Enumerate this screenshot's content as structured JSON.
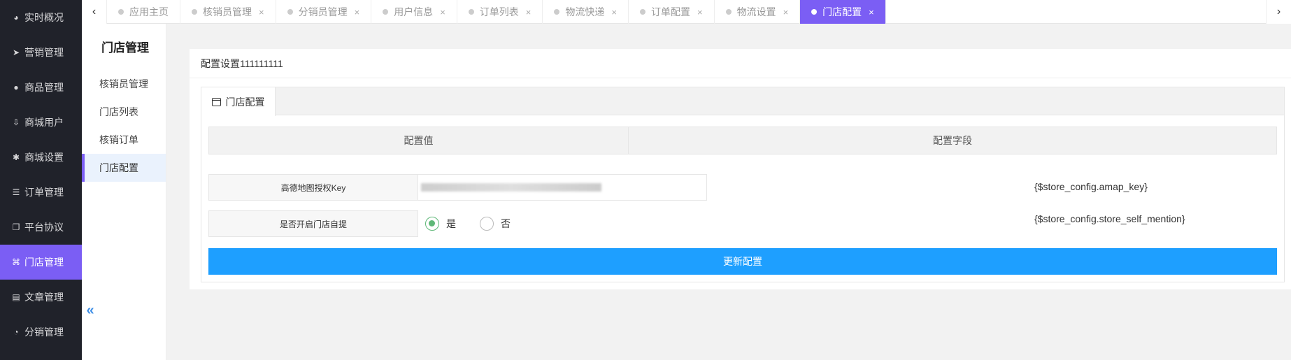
{
  "sidebar": {
    "items": [
      {
        "label": "实时概况",
        "icon": "dashboard-icon",
        "glyph": "◕"
      },
      {
        "label": "营销管理",
        "icon": "paper-plane-icon",
        "glyph": "➤"
      },
      {
        "label": "商品管理",
        "icon": "reddit-icon",
        "glyph": "●"
      },
      {
        "label": "商城用户",
        "icon": "user-upload-icon",
        "glyph": "⇩"
      },
      {
        "label": "商城设置",
        "icon": "asterisk-icon",
        "glyph": "✱"
      },
      {
        "label": "订单管理",
        "icon": "list-icon",
        "glyph": "☰"
      },
      {
        "label": "平台协议",
        "icon": "copy-icon",
        "glyph": "❐"
      },
      {
        "label": "门店管理",
        "icon": "binoculars-icon",
        "glyph": "⌘"
      },
      {
        "label": "文章管理",
        "icon": "book-icon",
        "glyph": "▤"
      },
      {
        "label": "分销管理",
        "icon": "pie-chart-icon",
        "glyph": "◔"
      }
    ],
    "active_index": 7
  },
  "subsidebar": {
    "title": "门店管理",
    "items": [
      "核销员管理",
      "门店列表",
      "核销订单",
      "门店配置"
    ],
    "active_index": 3,
    "collapse_glyph": "«"
  },
  "tabbar": {
    "left_arrow": "‹",
    "right_arrow": "›",
    "tabs": [
      {
        "label": "应用主页",
        "closable": false
      },
      {
        "label": "核销员管理",
        "closable": true
      },
      {
        "label": "分销员管理",
        "closable": true
      },
      {
        "label": "用户信息",
        "closable": true
      },
      {
        "label": "订单列表",
        "closable": true
      },
      {
        "label": "物流快递",
        "closable": true
      },
      {
        "label": "订单配置",
        "closable": true
      },
      {
        "label": "物流设置",
        "closable": true
      },
      {
        "label": "门店配置",
        "closable": true
      }
    ],
    "active_index": 8,
    "close_glyph": "×"
  },
  "card": {
    "title": "配置设置111111111",
    "panel_tab": "门店配置",
    "table_headers": {
      "value": "配置值",
      "field": "配置字段"
    },
    "rows": [
      {
        "label": "高德地图授权Key",
        "type": "text",
        "value": "",
        "field": "{$store_config.amap_key}"
      },
      {
        "label": "是否开启门店自提",
        "type": "radio",
        "options": [
          "是",
          "否"
        ],
        "selected": 0,
        "field": "{$store_config.store_self_mention}"
      }
    ],
    "submit_label": "更新配置"
  },
  "colors": {
    "accent": "#7b5ef4",
    "primary_button": "#1e9fff",
    "radio_checked": "#5fb878",
    "sidebar_bg": "#20222a"
  }
}
